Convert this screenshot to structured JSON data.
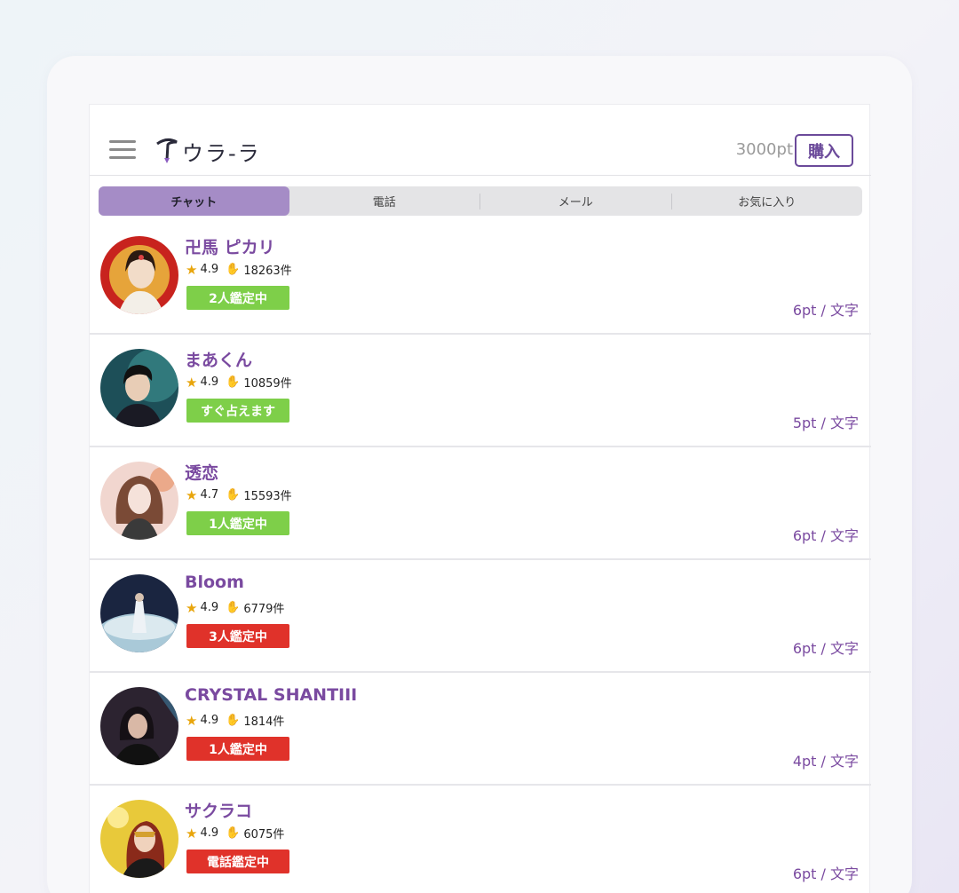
{
  "header": {
    "app_name": "ウラ-ラ",
    "points": "3000pt",
    "buy_label": "購入"
  },
  "tabs": [
    {
      "label": "チャット",
      "active": true
    },
    {
      "label": "電話",
      "active": false
    },
    {
      "label": "メール",
      "active": false
    },
    {
      "label": "お気に入り",
      "active": false
    }
  ],
  "fortune_tellers": [
    {
      "name": "卍馬 ピカリ",
      "rating": "4.9",
      "count": "18263件",
      "status": "2人鑑定中",
      "status_color": "#7ecf49",
      "price": "6pt / 文字"
    },
    {
      "name": "まあくん",
      "rating": "4.9",
      "count": "10859件",
      "status": "すぐ占えます",
      "status_color": "#7ecf49",
      "price": "5pt / 文字"
    },
    {
      "name": "透恋",
      "rating": "4.7",
      "count": "15593件",
      "status": "1人鑑定中",
      "status_color": "#7ecf49",
      "price": "6pt / 文字"
    },
    {
      "name": "Bloom",
      "rating": "4.9",
      "count": "6779件",
      "status": "3人鑑定中",
      "status_color": "#e0322a",
      "price": "6pt / 文字"
    },
    {
      "name": "CRYSTAL SHANTIII",
      "rating": "4.9",
      "count": "1814件",
      "status": "1人鑑定中",
      "status_color": "#e0322a",
      "price": "4pt / 文字"
    },
    {
      "name": "サクラコ",
      "rating": "4.9",
      "count": "6075件",
      "status": "電話鑑定中",
      "status_color": "#e0322a",
      "price": "6pt / 文字"
    }
  ],
  "colors": {
    "accent": "#7a4aa0",
    "tab_active": "#a58cc6",
    "busy_green": "#7ecf49",
    "busy_red": "#e0322a",
    "star": "#e8a50c"
  }
}
